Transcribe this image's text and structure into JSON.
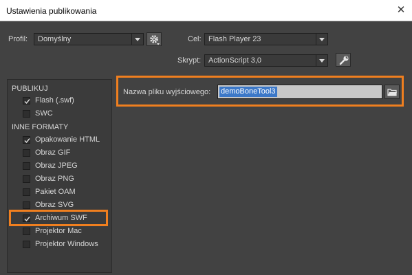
{
  "window": {
    "title": "Ustawienia publikowania",
    "close_glyph": "✕"
  },
  "profile": {
    "label": "Profil:",
    "value": "Domyślny"
  },
  "target": {
    "label": "Cel:",
    "value": "Flash Player 23"
  },
  "script": {
    "label": "Skrypt:",
    "value": "ActionScript 3,0"
  },
  "sidebar": {
    "publish_heading": "PUBLIKUJ",
    "publish_items": [
      {
        "label": "Flash (.swf)",
        "checked": true
      },
      {
        "label": "SWC",
        "checked": false
      }
    ],
    "other_heading": "INNE FORMATY",
    "other_items": [
      {
        "label": "Opakowanie HTML",
        "checked": true
      },
      {
        "label": "Obraz GIF",
        "checked": false
      },
      {
        "label": "Obraz JPEG",
        "checked": false
      },
      {
        "label": "Obraz PNG",
        "checked": false
      },
      {
        "label": "Pakiet OAM",
        "checked": false
      },
      {
        "label": "Obraz SVG",
        "checked": false
      },
      {
        "label": "Archiwum SWF",
        "checked": true
      },
      {
        "label": "Projektor Mac",
        "checked": false
      },
      {
        "label": "Projektor Windows",
        "checked": false
      }
    ]
  },
  "output": {
    "label": "Nazwa pliku wyjściowego:",
    "value": "demoBoneTool3"
  },
  "icons": {
    "profile_settings": "gear-icon",
    "script_settings": "wrench-icon",
    "browse": "folder-icon",
    "checkmark": "checkmark-icon"
  },
  "colors": {
    "highlight": "#f07f1f",
    "selection": "#3c78c8",
    "panel": "#424242"
  }
}
